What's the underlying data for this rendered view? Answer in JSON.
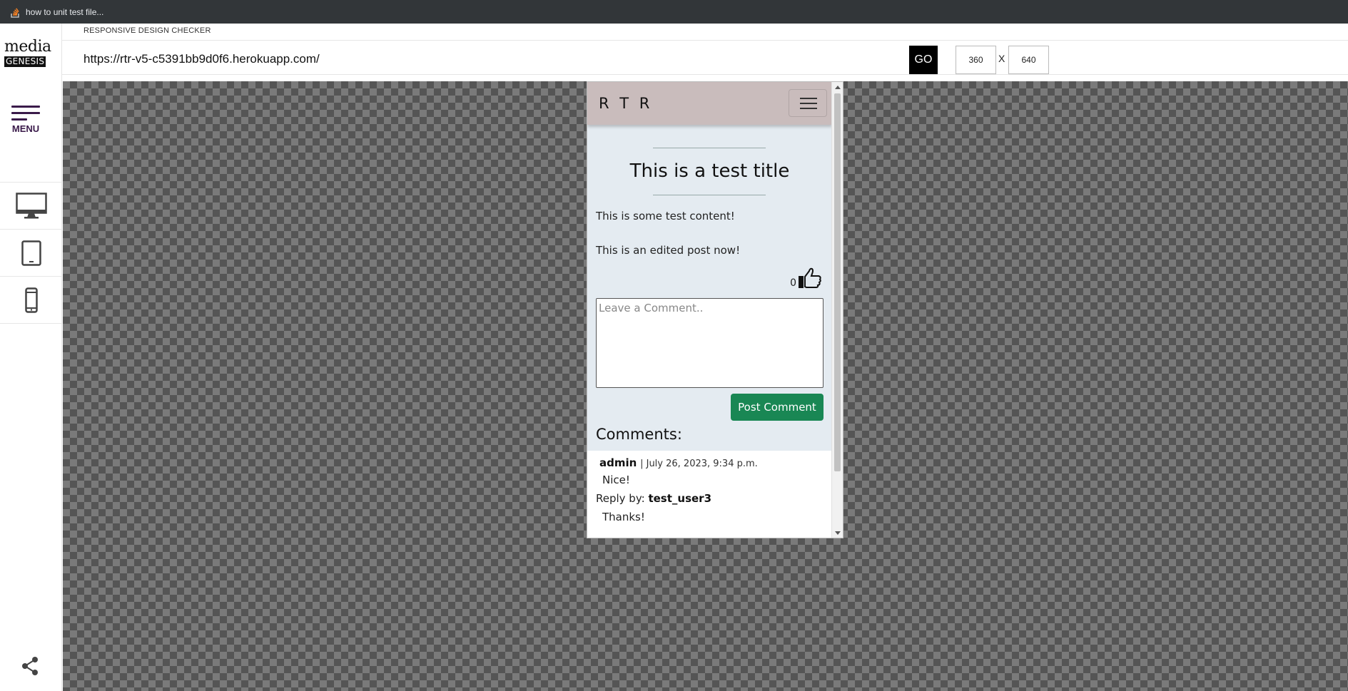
{
  "browser_tab": {
    "title": "how to unit test file..."
  },
  "sidebar": {
    "logo_line1": "media",
    "logo_line2": "GENESIS",
    "menu_label": "MENU",
    "devices": [
      "desktop-icon",
      "tablet-icon",
      "phone-icon"
    ]
  },
  "header": {
    "label": "RESPONSIVE DESIGN CHECKER",
    "url": "https://rtr-v5-c5391bb9d0f6.herokuapp.com/",
    "go_label": "GO",
    "width": "360",
    "x_label": "X",
    "height": "640"
  },
  "site": {
    "brand": "R T R",
    "post": {
      "title": "This is a test title",
      "paragraphs": [
        "This is some test content!",
        "This is an edited post now!"
      ],
      "likes": "0"
    },
    "comment_placeholder": "Leave a Comment..",
    "post_button": "Post Comment",
    "comments_heading": "Comments:",
    "comments": [
      {
        "author": "admin",
        "date": "| July 26, 2023, 9:34 p.m.",
        "body": "Nice!",
        "reply_prefix": "Reply by:",
        "reply_author": "test_user3",
        "reply_body": "Thanks!"
      }
    ]
  },
  "colors": {
    "tabbar": "#323639",
    "navbar": "#c9bcbc",
    "page_bg": "#e4ebf1",
    "button_green": "#198754",
    "menu_purple": "#3a1a4a"
  }
}
